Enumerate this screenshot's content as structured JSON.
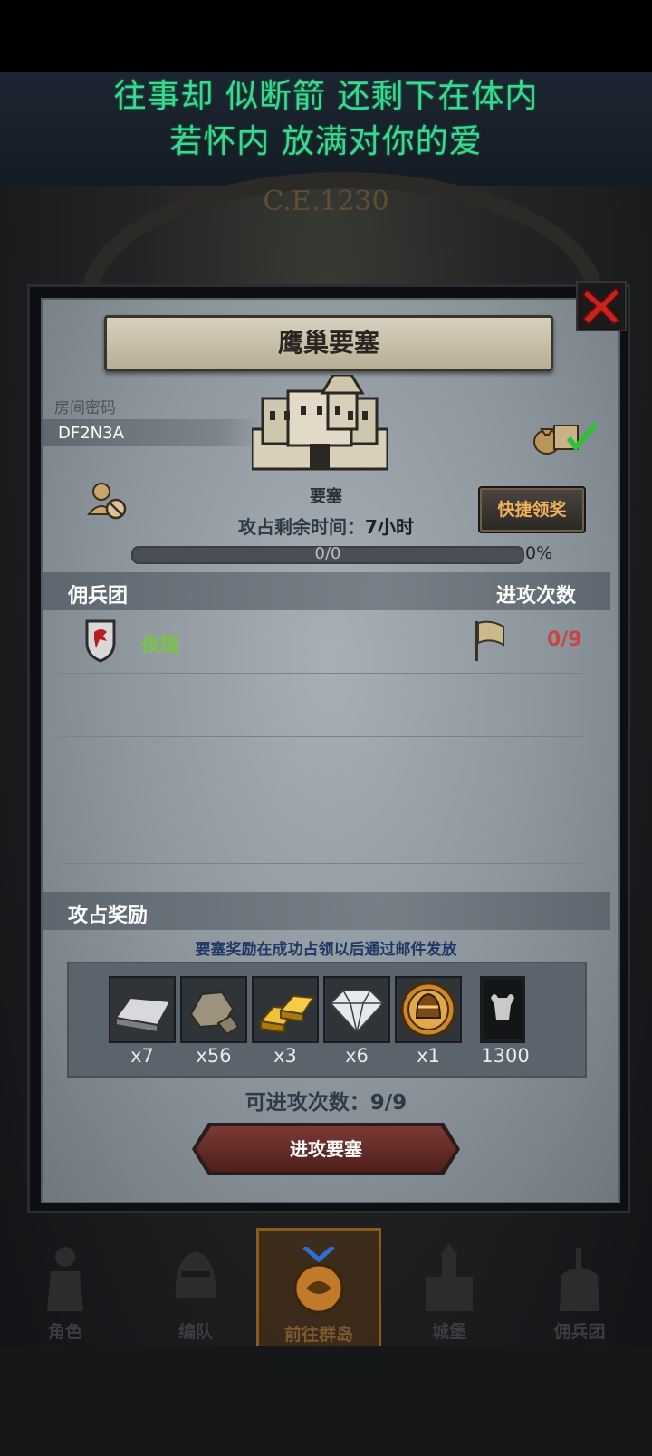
{
  "lyrics": {
    "line1": "往事却 似断箭 还剩下在体内",
    "line2": "若怀内 放满对你的爱"
  },
  "era": "C.E.1230",
  "dialog": {
    "title": "鹰巢要塞",
    "room_label": "房间密码",
    "room_code": "DF2N3A",
    "fort_label": "要塞",
    "quick_claim": "快捷领奖",
    "remain_label": "攻占剩余时间：",
    "remain_value": "7小时",
    "progress": {
      "text": "0/0",
      "percent": "0%",
      "fraction": 0
    },
    "merc_header": "佣兵团",
    "attacks_header": "进攻次数",
    "mercenaries": [
      {
        "name": "夜煌",
        "attacks": "0/9"
      }
    ],
    "reward_header": "攻占奖励",
    "reward_note": "要塞奖励在成功占领以后通过邮件发放",
    "rewards": [
      {
        "icon": "iron-bar-icon",
        "qty": "x7"
      },
      {
        "icon": "stone-icon",
        "qty": "x56"
      },
      {
        "icon": "gold-bars-icon",
        "qty": "x3"
      },
      {
        "icon": "diamond-icon",
        "qty": "x6"
      },
      {
        "icon": "knight-helmet-coin-icon",
        "qty": "x1"
      },
      {
        "icon": "bull-banner-icon",
        "qty": "1300"
      }
    ],
    "attacks_left_label": "可进攻次数：",
    "attacks_left_value": "9/9",
    "attack_button": "进攻要塞"
  },
  "nav": [
    {
      "label": "角色",
      "icon": "knight-icon"
    },
    {
      "label": "编队",
      "icon": "helmet-icon"
    },
    {
      "label": "前往群岛",
      "icon": "island-emblem-icon",
      "active": true
    },
    {
      "label": "城堡",
      "icon": "castle-icon"
    },
    {
      "label": "佣兵团",
      "icon": "mercenary-icon"
    }
  ],
  "colors": {
    "lyrics": "#3fd49a",
    "merc_name": "#7dc34b",
    "attack_count": "#c94444",
    "quick_btn_text": "#f1b25a"
  }
}
